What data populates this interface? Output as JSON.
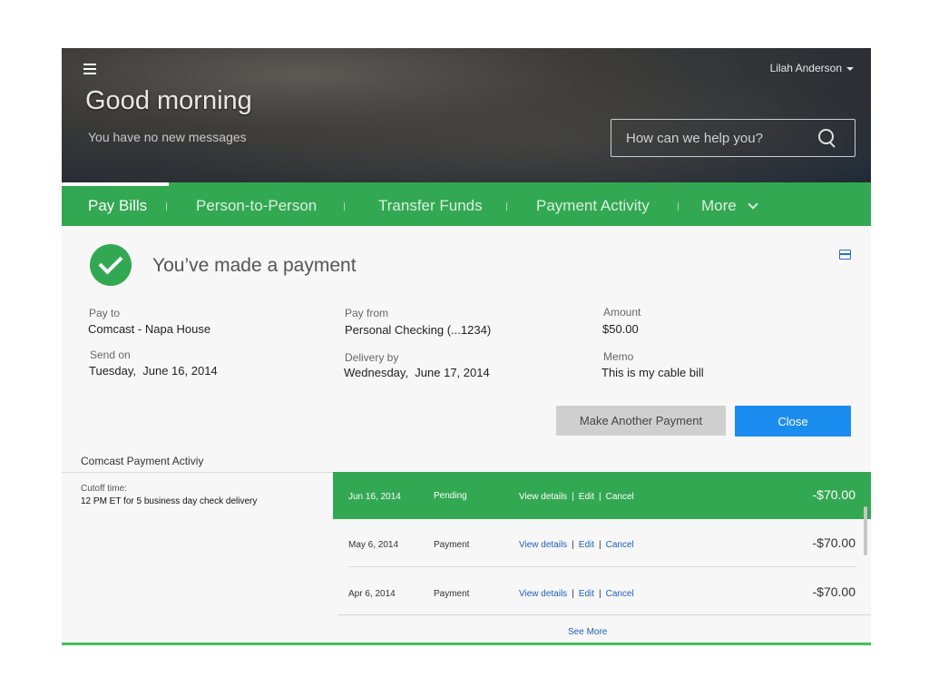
{
  "header": {
    "user_name": "Lilah Anderson",
    "greeting": "Good morning",
    "messages": "You have no new messages",
    "search_placeholder": "How can we help you?"
  },
  "nav": {
    "items": [
      {
        "label": "Pay Bills",
        "active": true
      },
      {
        "label": "Person-to-Person"
      },
      {
        "label": "Transfer Funds"
      },
      {
        "label": "Payment Activity"
      },
      {
        "label": "More"
      }
    ]
  },
  "confirmation": {
    "title": "You’ve made a payment",
    "pay_to_label": "Pay to",
    "pay_to": "Comcast - Napa House",
    "send_on_label": "Send on",
    "send_on": "Tuesday,  June 16, 2014",
    "pay_from_label": "Pay from",
    "pay_from": "Personal Checking (...1234)",
    "delivery_label": "Delivery by",
    "delivery": "Wednesday,  June 17, 2014",
    "amount_label": "Amount",
    "amount": "$50.00",
    "memo_label": "Memo",
    "memo": "This is my cable bill",
    "another_button": "Make Another Payment",
    "close_button": "Close"
  },
  "activity": {
    "title": "Comcast Payment Activiy",
    "cutoff_label": "Cutoff time:",
    "cutoff_value": "12 PM ET for 5 business day check delivery",
    "rows": [
      {
        "date": "Jun 16, 2014",
        "status": "Pending",
        "view": "View details",
        "edit": "Edit",
        "cancel": "Cancel",
        "amount": "-$70.00"
      },
      {
        "date": "May 6, 2014",
        "status": "Payment",
        "view": "View details",
        "edit": "Edit",
        "cancel": "Cancel",
        "amount": "-$70.00"
      },
      {
        "date": "Apr 6, 2014",
        "status": "Payment",
        "view": "View details",
        "edit": "Edit",
        "cancel": "Cancel",
        "amount": "-$70.00"
      }
    ],
    "see_more": "See More"
  },
  "colors": {
    "brand_green": "#33a852",
    "primary_blue": "#1a8cf0",
    "link_blue": "#1f5fbf"
  }
}
